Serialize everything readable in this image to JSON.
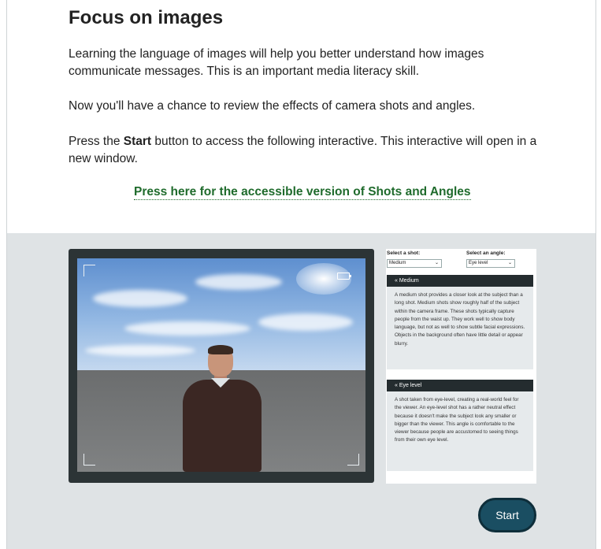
{
  "heading": "Focus on images",
  "paragraph1": "Learning the language of images will help you better understand how images communicate messages. This is an important media literacy skill.",
  "paragraph2": "Now you'll have a chance to review the effects of camera shots and angles.",
  "paragraph3": {
    "before": "Press the ",
    "bold": "Start",
    "after": " button to access the following interactive. This interactive will open in a new window."
  },
  "accessible_link": "Press here for the accessible version of Shots and Angles",
  "interactive": {
    "shot_label": "Select a shot:",
    "shot_value": "Medium",
    "angle_label": "Select an angle:",
    "angle_value": "Eye level",
    "shot_panel": {
      "title": "« Medium",
      "body": "A medium shot provides a closer look at the subject than a long shot. Medium shots show roughly half of the subject within the camera frame. These shots typically capture people from the waist up. They work well to show body language, but not as well to show subtle facial expressions. Objects in the background often have little detail or appear blurry."
    },
    "angle_panel": {
      "title": "« Eye level",
      "body": "A shot taken from eye-level, creating a real-world feel for the viewer. An eye-level shot has a rather neutral effect because it doesn't make the subject look any smaller or bigger than the viewer. This angle is comfortable to the viewer because people are accustomed to seeing things from their own eye level."
    },
    "start_label": "Start"
  },
  "colors": {
    "link": "#1f6b2c",
    "interactive_bg": "#dfe3e5",
    "start_button": "#1a4e62",
    "panel_header": "#242c2f"
  }
}
